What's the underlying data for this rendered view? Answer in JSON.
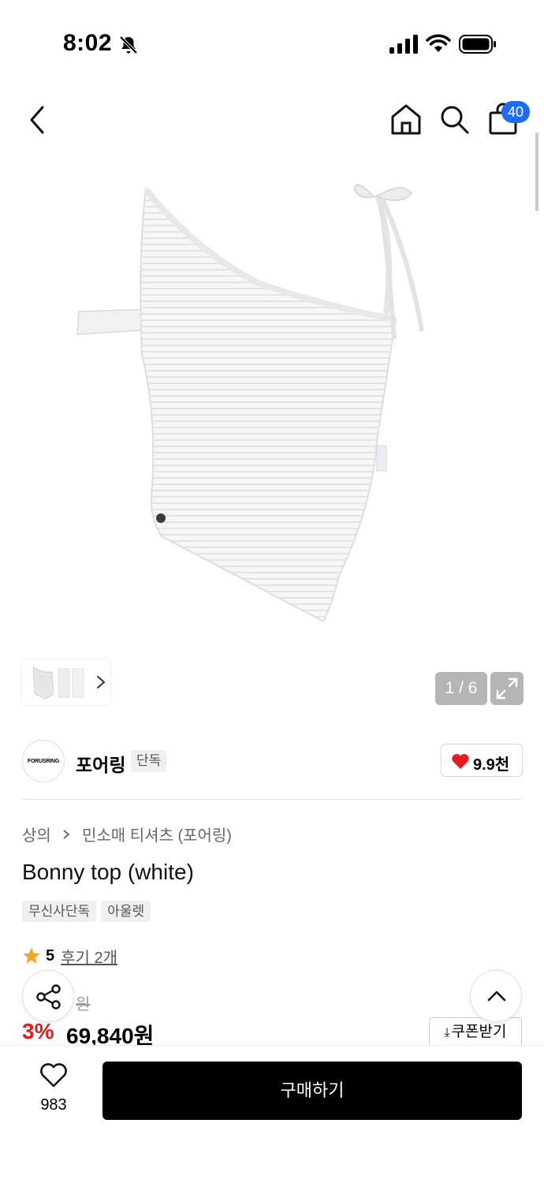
{
  "status_bar": {
    "time": "8:02"
  },
  "nav": {
    "cart_count": "40"
  },
  "gallery": {
    "page_counter": "1 / 6"
  },
  "brand": {
    "logo_text": "FORUSRING",
    "name": "포어링",
    "tag": "단독",
    "likes": "9.9천"
  },
  "breadcrumb": {
    "category": "상의",
    "subcategory": "민소매 티셔츠 (포어링)"
  },
  "product": {
    "title": "Bonny top (white)",
    "tags": [
      "무신사단독",
      "아울렛"
    ],
    "rating": "5",
    "review_link": "후기 2개",
    "original_price_suffix": "원",
    "discount": "3%",
    "sale_price": "69,840원",
    "coupon_label": "쿠폰받기"
  },
  "bottom_bar": {
    "wish_count": "983",
    "buy_label": "구매하기"
  },
  "colors": {
    "accent_blue": "#1f6bff",
    "sale_red": "#e11d1d",
    "heart_red": "#e41b23",
    "star_orange": "#f5a623"
  }
}
